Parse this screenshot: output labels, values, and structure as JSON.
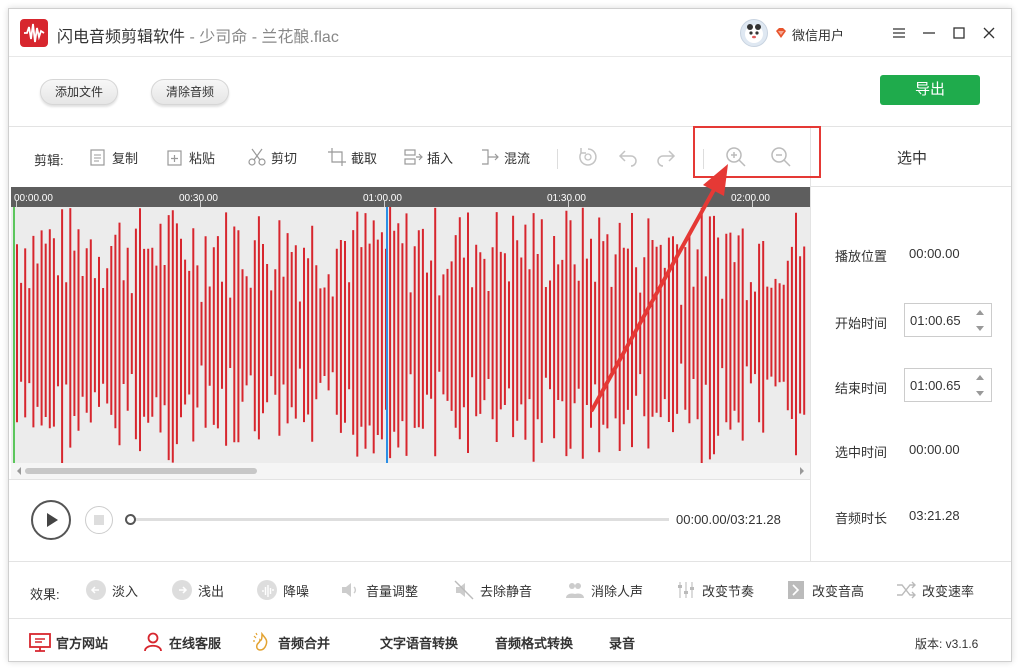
{
  "app": {
    "name": "闪电音频剪辑软件",
    "separator": "-",
    "file": "少司命 - 兰花酿.flac",
    "user": "微信用户"
  },
  "actions": {
    "add_file": "添加文件",
    "clear_audio": "清除音频",
    "export": "导出"
  },
  "toolbar": {
    "label": "剪辑:",
    "copy": "复制",
    "paste": "粘贴",
    "cut": "剪切",
    "crop": "截取",
    "insert": "插入",
    "mix": "混流"
  },
  "timeline": {
    "ticks": [
      "00:00.00",
      "00:30.00",
      "01:00.00",
      "01:30.00",
      "02:00.00"
    ]
  },
  "player": {
    "time": "00:00.00/03:21.28"
  },
  "selection": {
    "title": "选中",
    "play_pos_label": "播放位置",
    "play_pos": "00:00.00",
    "start_label": "开始时间",
    "start": "01:00.65",
    "end_label": "结束时间",
    "end": "01:00.65",
    "duration_label": "选中时间",
    "duration": "00:00.00",
    "total_label": "音频时长",
    "total": "03:21.28"
  },
  "effects": {
    "label": "效果:",
    "items": [
      "淡入",
      "浅出",
      "降噪",
      "音量调整",
      "去除静音",
      "消除人声",
      "改变节奏",
      "改变音高",
      "改变速率"
    ]
  },
  "footer": {
    "items": [
      "官方网站",
      "在线客服",
      "音频合并",
      "文字语音转换",
      "音频格式转换",
      "录音"
    ],
    "version": "版本: v3.1.6"
  },
  "colors": {
    "waveform": "#d7262e",
    "export": "#1fab4c",
    "annotation": "#e53935",
    "playhead": "#2b8fe6",
    "start_marker": "#5cc65c"
  }
}
